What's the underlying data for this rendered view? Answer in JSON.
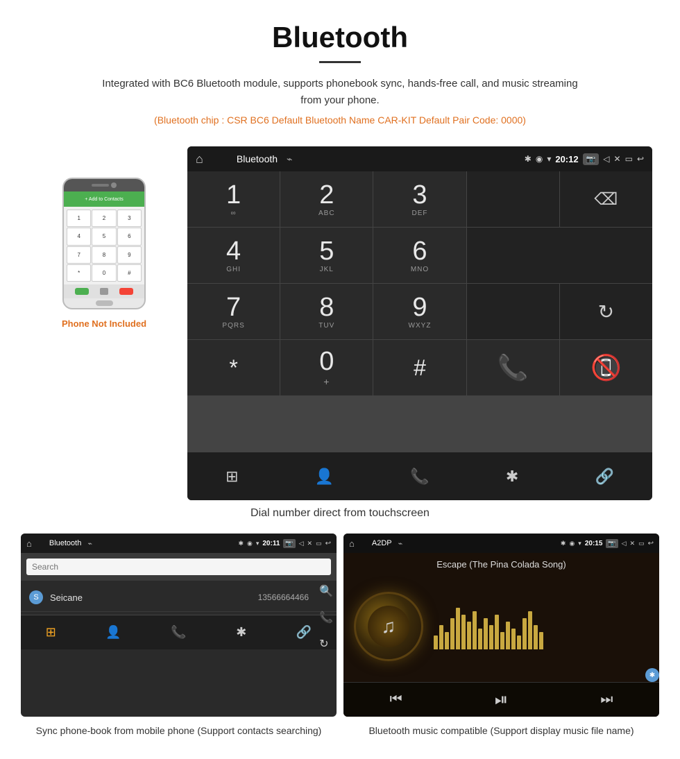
{
  "header": {
    "title": "Bluetooth",
    "underline": true,
    "description": "Integrated with BC6 Bluetooth module, supports phonebook sync, hands-free call, and music streaming from your phone.",
    "specs": "(Bluetooth chip : CSR BC6    Default Bluetooth Name CAR-KIT    Default Pair Code: 0000)"
  },
  "main_caption": "Dial number direct from touchscreen",
  "dialpad": {
    "status_bar": {
      "title": "Bluetooth",
      "usb_icon": "⌁",
      "time": "20:12",
      "bt_icon": "❊",
      "location_icon": "◉",
      "signal_icon": "▾",
      "camera_icon": "⬜",
      "volume_icon": "▷",
      "close_icon": "✕",
      "window_icon": "▭",
      "back_icon": "↩"
    },
    "keys": [
      {
        "num": "1",
        "sub": "∞",
        "col": 1,
        "row": 1
      },
      {
        "num": "2",
        "sub": "ABC",
        "col": 2,
        "row": 1
      },
      {
        "num": "3",
        "sub": "DEF",
        "col": 3,
        "row": 1
      },
      {
        "num": "4",
        "sub": "GHI",
        "col": 1,
        "row": 2
      },
      {
        "num": "5",
        "sub": "JKL",
        "col": 2,
        "row": 2
      },
      {
        "num": "6",
        "sub": "MNO",
        "col": 3,
        "row": 2
      },
      {
        "num": "7",
        "sub": "PQRS",
        "col": 1,
        "row": 3
      },
      {
        "num": "8",
        "sub": "TUV",
        "col": 2,
        "row": 3
      },
      {
        "num": "9",
        "sub": "WXYZ",
        "col": 3,
        "row": 3
      },
      {
        "num": "*",
        "sub": "",
        "col": 1,
        "row": 4
      },
      {
        "num": "0",
        "sub": "+",
        "col": 2,
        "row": 4
      },
      {
        "num": "#",
        "sub": "",
        "col": 3,
        "row": 4
      }
    ],
    "bottom_nav_icons": [
      "⊞",
      "👤",
      "📞",
      "✱",
      "🔗"
    ]
  },
  "phone_area": {
    "not_included_text": "Phone Not Included",
    "screen_header_text": "+ Add to Contacts",
    "keys": [
      "1",
      "2",
      "3",
      "4",
      "5",
      "6",
      "7",
      "8",
      "9",
      "*",
      "0",
      "#"
    ]
  },
  "left_panel": {
    "status": {
      "title": "Bluetooth",
      "time": "20:11"
    },
    "search_placeholder": "Search",
    "contacts": [
      {
        "letter": "S",
        "name": "Seicane",
        "phone": "13566664466"
      }
    ],
    "caption": "Sync phone-book from mobile phone\n(Support contacts searching)"
  },
  "right_panel": {
    "status": {
      "title": "A2DP",
      "time": "20:15"
    },
    "song_title": "Escape (The Pina Colada Song)",
    "eq_bars": [
      20,
      35,
      25,
      45,
      60,
      50,
      40,
      55,
      30,
      45,
      35,
      50,
      25,
      40,
      30,
      20,
      45,
      55,
      35,
      25
    ],
    "caption": "Bluetooth music compatible\n(Support display music file name)",
    "controls": {
      "prev": "⏮",
      "play_pause": "⏯",
      "next": "⏭"
    }
  },
  "colors": {
    "accent_orange": "#e07020",
    "accent_blue": "#5b9bd5",
    "call_green": "#4caf50",
    "call_red": "#f44336",
    "dark_bg": "#2a2a2a",
    "darker_bg": "#1a1a1a"
  }
}
